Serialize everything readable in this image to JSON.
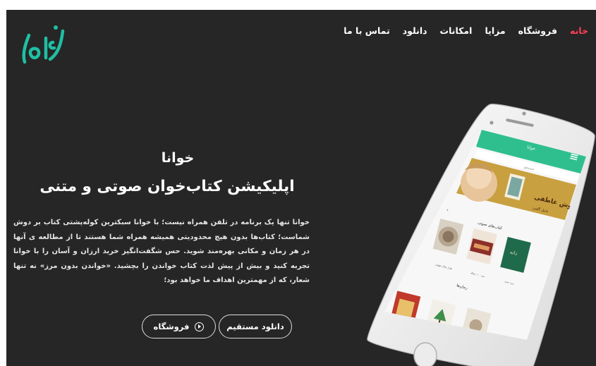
{
  "brand": {
    "logo_text": "خوانا",
    "accent": "#1fbfa3"
  },
  "nav": {
    "items": [
      {
        "label": "خانه",
        "active": true
      },
      {
        "label": "فروشگاه",
        "active": false
      },
      {
        "label": "مزایا",
        "active": false
      },
      {
        "label": "امکانات",
        "active": false
      },
      {
        "label": "دانلود",
        "active": false
      },
      {
        "label": "تماس با ما",
        "active": false
      }
    ]
  },
  "hero": {
    "title": "خوانا",
    "subtitle": "اپلیکیشن کتاب‌خوان صوتی و متنی",
    "description": "خوانا تنها یک برنامه در تلفن همراه نیست؛ با خوانا سبکترین کولەپشتی کتاب بر دوش شماست؛ کتاب‌ها بدون هیچ محدودیتی همیشه همراه شما هستند تا از مطالعه ی آنها در هر زمان و مکانی بهرەمند شوید. حس شگفت‌انگیز خرید ارزان و آسان را با خوانا تجربه کنید و بیش از پیش لذت کتاب خواندن را بچشید. «خواندن بدون مرز» نه تنها شعار، که از مهمترین اهداف ما خواهد بود؛",
    "buttons": {
      "direct_download": "دانلود مستقیم",
      "store": "فروشگاه"
    }
  },
  "phone": {
    "app_bar_title": "خوانا",
    "search_placeholder": "جستجو",
    "banner_title": "هوش عاطفی",
    "banner_author": "دانیل گلمن",
    "section_audio": "کتاب‌های صوتی",
    "section_novels": "رمان‌ها",
    "book_captions": [
      "هزار سال تنهایی",
      "مرد ۱۰۰ ساله",
      "مرد جدید"
    ],
    "colors": {
      "app_bar": "#2fbf8f",
      "banner_bg": "#c9a040"
    }
  }
}
